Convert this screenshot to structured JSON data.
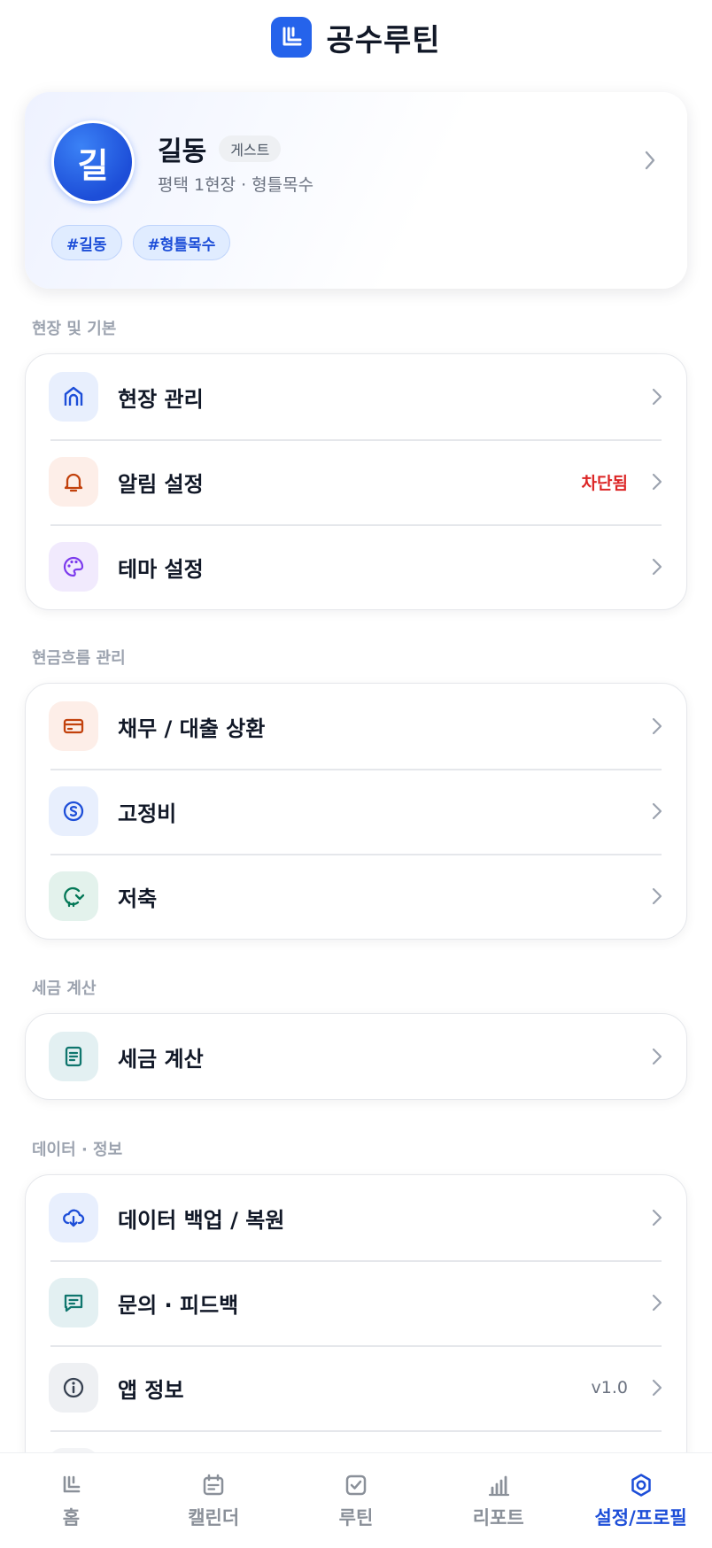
{
  "header": {
    "title": "공수루틴",
    "logo_icon": "app-logo-icon"
  },
  "profile": {
    "avatar_text": "길",
    "name": "길동",
    "badge": "게스트",
    "subtitle": "평택 1현장 · 형틀목수",
    "tags": [
      "#길동",
      "#형틀목수"
    ]
  },
  "sections": {
    "site": {
      "title": "현장 및 기본",
      "items": [
        {
          "label": "현장 관리",
          "value": "",
          "icon": "home-icon"
        },
        {
          "label": "알림 설정",
          "value": "차단됨",
          "icon": "bell-icon"
        },
        {
          "label": "테마 설정",
          "value": "",
          "icon": "palette-icon"
        }
      ]
    },
    "cashflow": {
      "title": "현금흐름 관리",
      "items": [
        {
          "label": "채무 / 대출 상환",
          "value": "",
          "icon": "credit-card-icon"
        },
        {
          "label": "고정비",
          "value": "",
          "icon": "coin-icon"
        },
        {
          "label": "저축",
          "value": "",
          "icon": "piggy-bank-icon"
        }
      ]
    },
    "tax": {
      "title": "세금 계산",
      "items": [
        {
          "label": "세금 계산",
          "value": "",
          "icon": "document-icon"
        }
      ]
    },
    "data": {
      "title": "데이터 · 정보",
      "items": [
        {
          "label": "데이터 백업 / 복원",
          "value": "",
          "icon": "cloud-upload-icon"
        },
        {
          "label": "문의 · 피드백",
          "value": "",
          "icon": "message-icon"
        },
        {
          "label": "앱 정보",
          "value": "v1.0",
          "icon": "info-icon"
        }
      ]
    }
  },
  "nav": {
    "items": [
      {
        "label": "홈",
        "icon": "home-logo-icon",
        "active": false
      },
      {
        "label": "캘린더",
        "icon": "calendar-icon",
        "active": false
      },
      {
        "label": "루틴",
        "icon": "routine-check-icon",
        "active": false
      },
      {
        "label": "리포트",
        "icon": "bar-chart-icon",
        "active": false
      },
      {
        "label": "설정/프로필",
        "icon": "settings-icon",
        "active": true
      }
    ]
  },
  "colors": {
    "accent": "#2563eb",
    "warning": "#dc2626",
    "nav_inactive": "#8a9099",
    "nav_active": "#1d4ed8"
  }
}
